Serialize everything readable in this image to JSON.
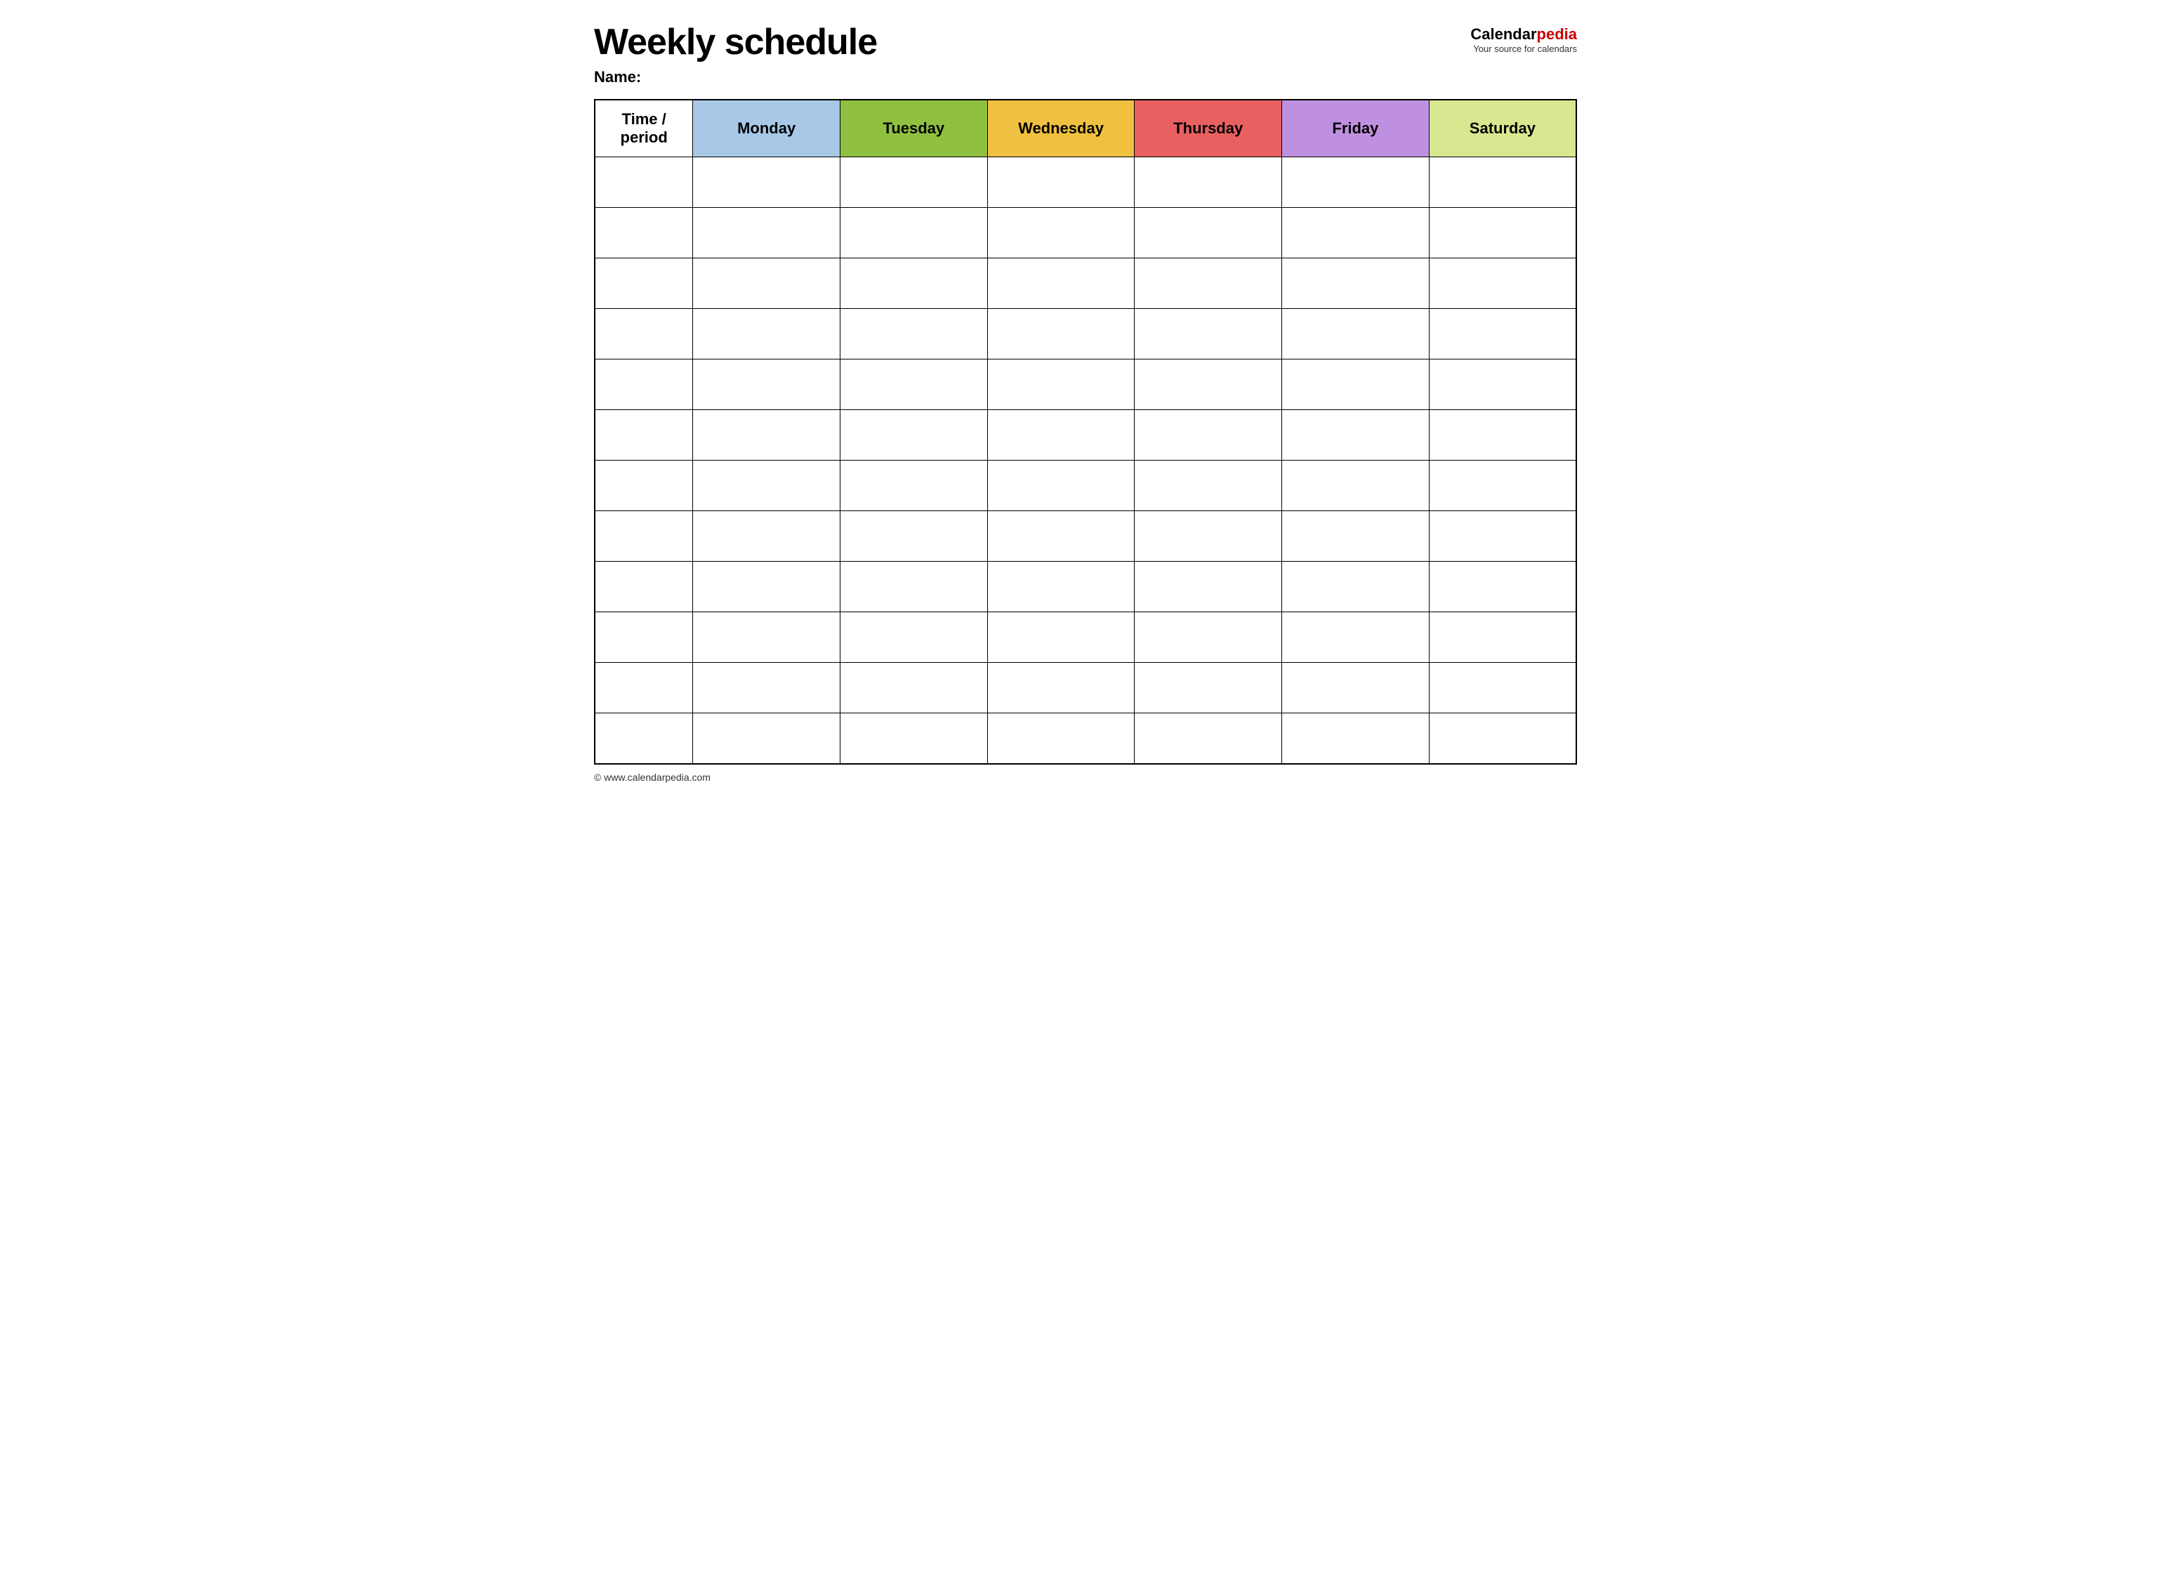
{
  "header": {
    "title": "Weekly schedule",
    "logo": {
      "part1": "Calendar",
      "part2": "pedia",
      "subtitle": "Your source for calendars",
      "url_display": "www.calendarpedia.com"
    }
  },
  "name_label": "Name:",
  "table": {
    "columns": [
      {
        "key": "time",
        "label": "Time / period",
        "color": "#ffffff"
      },
      {
        "key": "monday",
        "label": "Monday",
        "color": "#a8c8e8"
      },
      {
        "key": "tuesday",
        "label": "Tuesday",
        "color": "#90c040"
      },
      {
        "key": "wednesday",
        "label": "Wednesday",
        "color": "#f0c040"
      },
      {
        "key": "thursday",
        "label": "Thursday",
        "color": "#e86060"
      },
      {
        "key": "friday",
        "label": "Friday",
        "color": "#c090e0"
      },
      {
        "key": "saturday",
        "label": "Saturday",
        "color": "#d8e890"
      }
    ],
    "row_count": 12
  },
  "footer": {
    "url": "© www.calendarpedia.com"
  }
}
